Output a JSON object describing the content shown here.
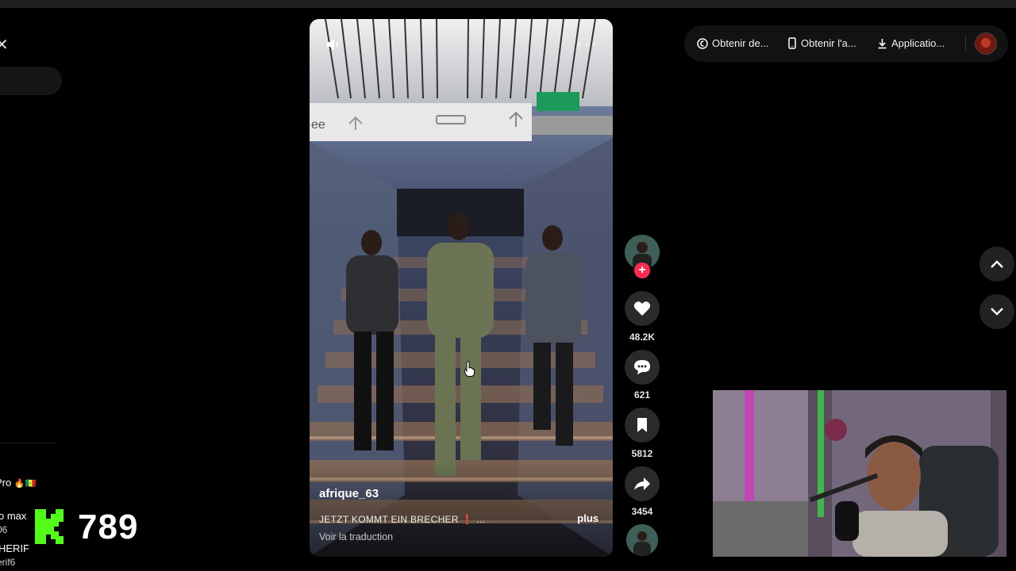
{
  "sidebar": {
    "entries": [
      {
        "name": "Pro",
        "emoji": "🔥🇸🇳"
      },
      {
        "name": "o max",
        "sub": "06"
      },
      {
        "name": "HERIF",
        "sub": "erif6"
      }
    ]
  },
  "kick_overlay": {
    "count": "789",
    "color": "#53fc18"
  },
  "video": {
    "author": "afrique_63",
    "description": "JETZT KOMMT EIN BRECHER ❗ ...",
    "more_label": "plus",
    "translate_label": "Voir la traduction",
    "more_menu": "···"
  },
  "actions": {
    "likes": "48.2K",
    "comments": "621",
    "saves": "5812",
    "shares": "3454",
    "follow_color": "#fe2c55"
  },
  "topbar": {
    "items": [
      {
        "label": "Obtenir de...",
        "icon": "coin-icon"
      },
      {
        "label": "Obtenir l'a...",
        "icon": "phone-icon"
      },
      {
        "label": "Applicatio...",
        "icon": "download-icon"
      }
    ]
  }
}
